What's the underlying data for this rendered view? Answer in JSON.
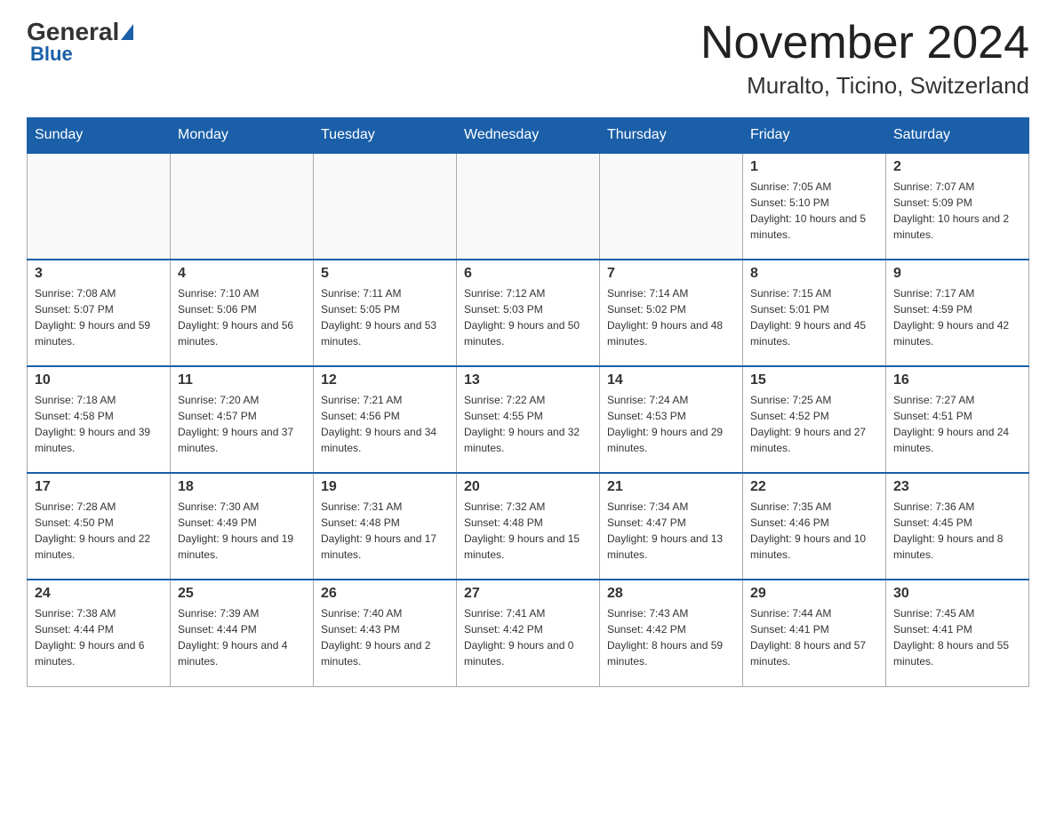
{
  "header": {
    "logo_general": "General",
    "logo_blue": "Blue",
    "month_title": "November 2024",
    "location": "Muralto, Ticino, Switzerland"
  },
  "days_of_week": [
    "Sunday",
    "Monday",
    "Tuesday",
    "Wednesday",
    "Thursday",
    "Friday",
    "Saturday"
  ],
  "weeks": [
    [
      {
        "day": "",
        "info": ""
      },
      {
        "day": "",
        "info": ""
      },
      {
        "day": "",
        "info": ""
      },
      {
        "day": "",
        "info": ""
      },
      {
        "day": "",
        "info": ""
      },
      {
        "day": "1",
        "info": "Sunrise: 7:05 AM\nSunset: 5:10 PM\nDaylight: 10 hours and 5 minutes."
      },
      {
        "day": "2",
        "info": "Sunrise: 7:07 AM\nSunset: 5:09 PM\nDaylight: 10 hours and 2 minutes."
      }
    ],
    [
      {
        "day": "3",
        "info": "Sunrise: 7:08 AM\nSunset: 5:07 PM\nDaylight: 9 hours and 59 minutes."
      },
      {
        "day": "4",
        "info": "Sunrise: 7:10 AM\nSunset: 5:06 PM\nDaylight: 9 hours and 56 minutes."
      },
      {
        "day": "5",
        "info": "Sunrise: 7:11 AM\nSunset: 5:05 PM\nDaylight: 9 hours and 53 minutes."
      },
      {
        "day": "6",
        "info": "Sunrise: 7:12 AM\nSunset: 5:03 PM\nDaylight: 9 hours and 50 minutes."
      },
      {
        "day": "7",
        "info": "Sunrise: 7:14 AM\nSunset: 5:02 PM\nDaylight: 9 hours and 48 minutes."
      },
      {
        "day": "8",
        "info": "Sunrise: 7:15 AM\nSunset: 5:01 PM\nDaylight: 9 hours and 45 minutes."
      },
      {
        "day": "9",
        "info": "Sunrise: 7:17 AM\nSunset: 4:59 PM\nDaylight: 9 hours and 42 minutes."
      }
    ],
    [
      {
        "day": "10",
        "info": "Sunrise: 7:18 AM\nSunset: 4:58 PM\nDaylight: 9 hours and 39 minutes."
      },
      {
        "day": "11",
        "info": "Sunrise: 7:20 AM\nSunset: 4:57 PM\nDaylight: 9 hours and 37 minutes."
      },
      {
        "day": "12",
        "info": "Sunrise: 7:21 AM\nSunset: 4:56 PM\nDaylight: 9 hours and 34 minutes."
      },
      {
        "day": "13",
        "info": "Sunrise: 7:22 AM\nSunset: 4:55 PM\nDaylight: 9 hours and 32 minutes."
      },
      {
        "day": "14",
        "info": "Sunrise: 7:24 AM\nSunset: 4:53 PM\nDaylight: 9 hours and 29 minutes."
      },
      {
        "day": "15",
        "info": "Sunrise: 7:25 AM\nSunset: 4:52 PM\nDaylight: 9 hours and 27 minutes."
      },
      {
        "day": "16",
        "info": "Sunrise: 7:27 AM\nSunset: 4:51 PM\nDaylight: 9 hours and 24 minutes."
      }
    ],
    [
      {
        "day": "17",
        "info": "Sunrise: 7:28 AM\nSunset: 4:50 PM\nDaylight: 9 hours and 22 minutes."
      },
      {
        "day": "18",
        "info": "Sunrise: 7:30 AM\nSunset: 4:49 PM\nDaylight: 9 hours and 19 minutes."
      },
      {
        "day": "19",
        "info": "Sunrise: 7:31 AM\nSunset: 4:48 PM\nDaylight: 9 hours and 17 minutes."
      },
      {
        "day": "20",
        "info": "Sunrise: 7:32 AM\nSunset: 4:48 PM\nDaylight: 9 hours and 15 minutes."
      },
      {
        "day": "21",
        "info": "Sunrise: 7:34 AM\nSunset: 4:47 PM\nDaylight: 9 hours and 13 minutes."
      },
      {
        "day": "22",
        "info": "Sunrise: 7:35 AM\nSunset: 4:46 PM\nDaylight: 9 hours and 10 minutes."
      },
      {
        "day": "23",
        "info": "Sunrise: 7:36 AM\nSunset: 4:45 PM\nDaylight: 9 hours and 8 minutes."
      }
    ],
    [
      {
        "day": "24",
        "info": "Sunrise: 7:38 AM\nSunset: 4:44 PM\nDaylight: 9 hours and 6 minutes."
      },
      {
        "day": "25",
        "info": "Sunrise: 7:39 AM\nSunset: 4:44 PM\nDaylight: 9 hours and 4 minutes."
      },
      {
        "day": "26",
        "info": "Sunrise: 7:40 AM\nSunset: 4:43 PM\nDaylight: 9 hours and 2 minutes."
      },
      {
        "day": "27",
        "info": "Sunrise: 7:41 AM\nSunset: 4:42 PM\nDaylight: 9 hours and 0 minutes."
      },
      {
        "day": "28",
        "info": "Sunrise: 7:43 AM\nSunset: 4:42 PM\nDaylight: 8 hours and 59 minutes."
      },
      {
        "day": "29",
        "info": "Sunrise: 7:44 AM\nSunset: 4:41 PM\nDaylight: 8 hours and 57 minutes."
      },
      {
        "day": "30",
        "info": "Sunrise: 7:45 AM\nSunset: 4:41 PM\nDaylight: 8 hours and 55 minutes."
      }
    ]
  ]
}
